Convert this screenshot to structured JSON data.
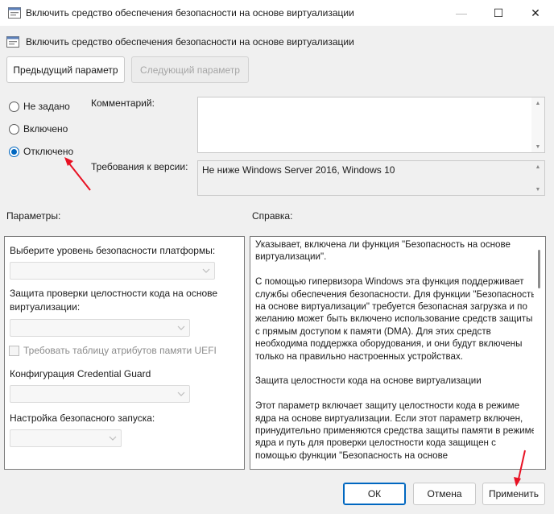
{
  "window": {
    "title": "Включить средство обеспечения безопасности на основе виртуализации",
    "controls": {
      "minimize": "—",
      "maximize": "☐",
      "close": "✕"
    }
  },
  "header": {
    "title": "Включить средство обеспечения безопасности на основе виртуализации"
  },
  "nav": {
    "prev_label": "Предыдущий параметр",
    "next_label": "Следующий параметр"
  },
  "state": {
    "options": [
      {
        "label": "Не задано",
        "checked": false
      },
      {
        "label": "Включено",
        "checked": false
      },
      {
        "label": "Отключено",
        "checked": true
      }
    ]
  },
  "comment": {
    "label": "Комментарий:",
    "value": ""
  },
  "requirements": {
    "label": "Требования к версии:",
    "value": "Не ниже Windows Server 2016, Windows 10"
  },
  "options_panel": {
    "label": "Параметры:",
    "platform_level_label": "Выберите уровень безопасности платформы:",
    "hvci_label_line1": "Защита проверки целостности кода на основе",
    "hvci_label_line2": "виртуализации:",
    "uefi_mat_label": "Требовать таблицу атрибутов памяти UEFI",
    "credential_guard_label": "Конфигурация Credential Guard",
    "secure_launch_label": "Настройка безопасного запуска:"
  },
  "help_panel": {
    "label": "Справка:",
    "paragraphs": [
      "Указывает, включена ли функция \"Безопасность на основе виртуализации\".",
      "С помощью гипервизора Windows эта функция поддерживает службы обеспечения безопасности. Для функции \"Безопасность на основе виртуализации\" требуется безопасная загрузка и по желанию может быть включено использование средств защиты с прямым доступом к памяти (DMA). Для этих средств необходима поддержка оборудования, и они будут включены только на правильно настроенных устройствах.",
      "Защита целостности кода на основе виртуализации",
      "Этот параметр включает защиту целостности кода в режиме ядра на основе виртуализации. Если этот параметр включен, принудительно применяются средства защиты памяти в режиме ядра и путь для проверки целостности кода защищен с помощью функции \"Безопасность на основе"
    ]
  },
  "footer": {
    "ok_label": "ОК",
    "cancel_label": "Отмена",
    "apply_label": "Применить"
  },
  "colors": {
    "accent": "#0067c0",
    "annotation_arrow": "#e81123"
  }
}
